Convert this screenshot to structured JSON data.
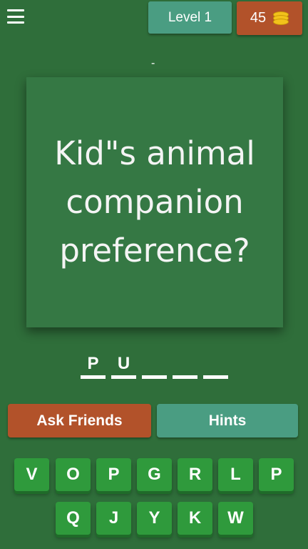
{
  "header": {
    "menu_icon": "hamburger-menu-icon",
    "level_label": "Level 1",
    "coins": "45",
    "coin_icon": "coin-stack-icon"
  },
  "marker": "-",
  "question": "Kid\"s animal companion preference?",
  "answer_slots": [
    "P",
    "U",
    "",
    "",
    ""
  ],
  "buttons": {
    "ask_friends": "Ask Friends",
    "hints": "Hints"
  },
  "keyboard": {
    "row1": [
      "V",
      "O",
      "P",
      "G",
      "R",
      "L",
      "P"
    ],
    "row2": [
      "Q",
      "J",
      "Y",
      "K",
      "W"
    ]
  },
  "colors": {
    "background": "#2f6e3a",
    "card": "#357844",
    "teal": "#4a9d82",
    "orange": "#b2522a",
    "key": "#2f9a3c"
  }
}
